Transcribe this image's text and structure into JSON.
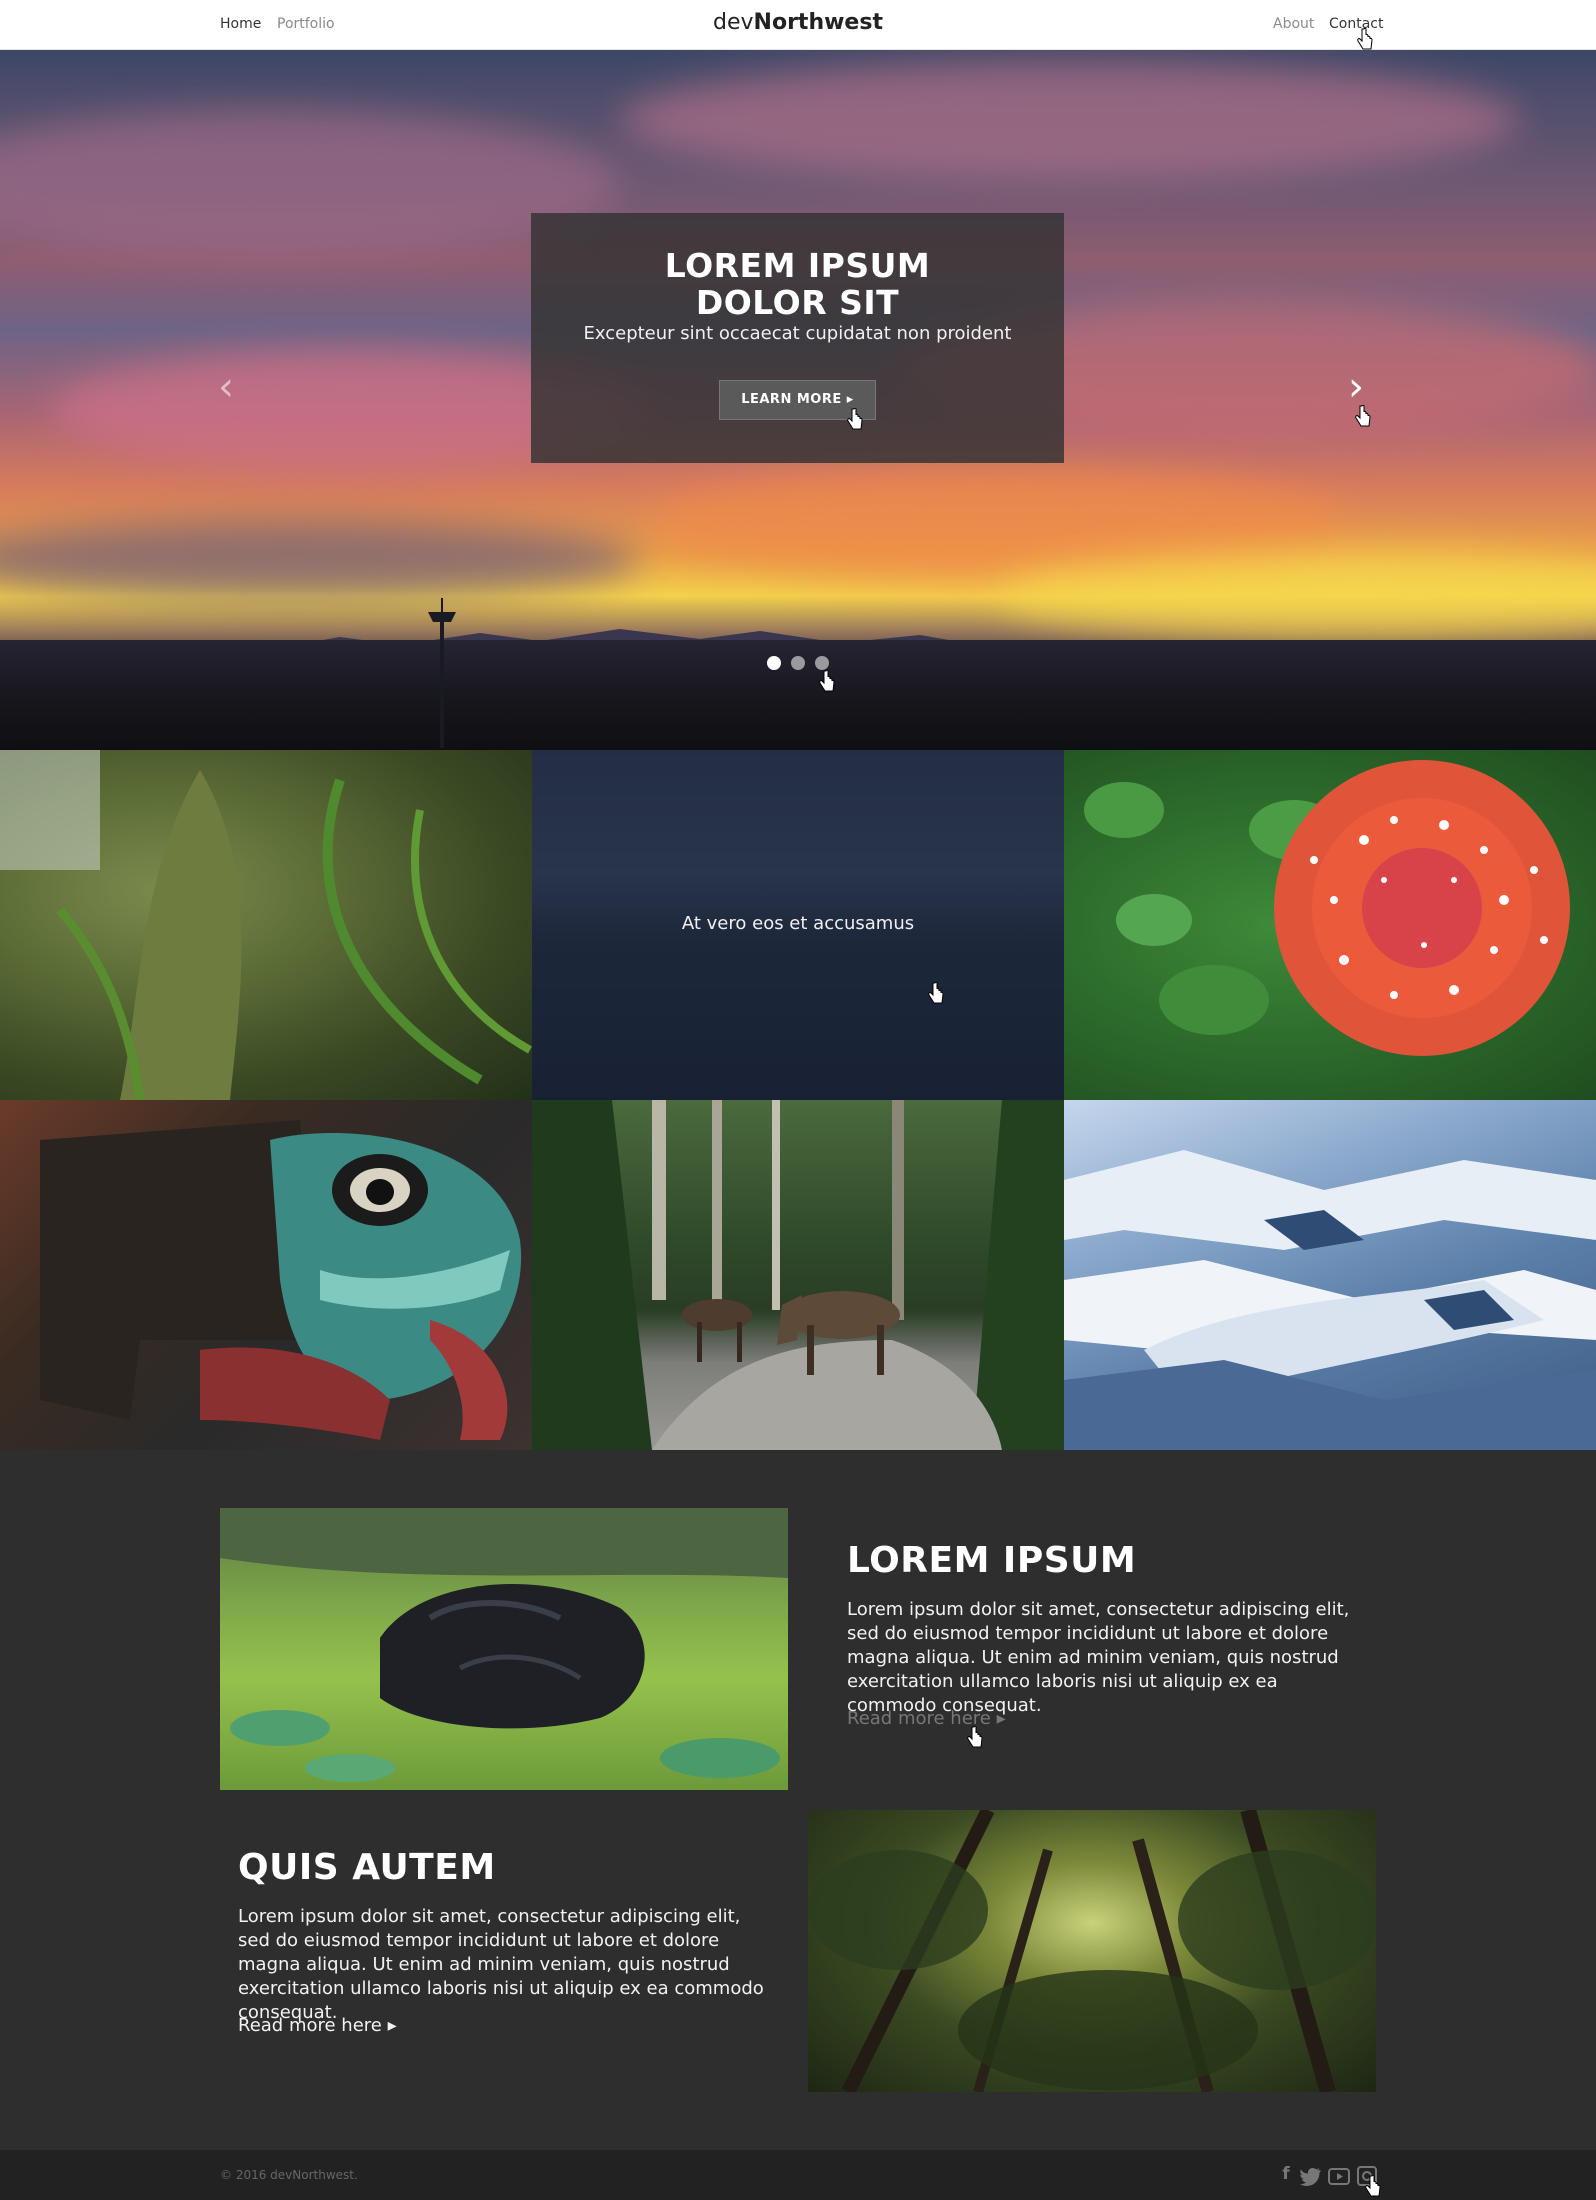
{
  "header": {
    "nav_left": [
      "Home",
      "Portfolio"
    ],
    "logo_light": "dev",
    "logo_bold": "Northwest",
    "nav_right": [
      "About",
      "Contact"
    ]
  },
  "hero": {
    "title_line1": "LOREM IPSUM",
    "title_line2": "DOLOR SIT",
    "subtitle": "Excepteur sint occaecat cupidatat non proident",
    "button_label": "LEARN MORE ▸",
    "prev_arrow": "‹",
    "next_arrow": "›",
    "slide_count": 3,
    "active_slide": 1
  },
  "gallery": {
    "tiles": [
      "moss-fern-photo",
      "ocean-dusk-photo",
      "mushroom-photo",
      "totem-photo",
      "moose-road-photo",
      "glacier-photo"
    ],
    "overlay_text": "At vero eos et accusamus"
  },
  "features": [
    {
      "title": "LOREM IPSUM",
      "text": "Lorem ipsum dolor sit amet, consectetur adipiscing elit, sed do eiusmod tempor incididunt ut labore et dolore magna aliqua. Ut enim ad minim veniam, quis nostrud exercitation ullamco laboris nisi ut aliquip ex ea commodo consequat.",
      "link": "Read more here ▸"
    },
    {
      "title": "QUIS AUTEM",
      "text": "Lorem ipsum dolor sit amet, consectetur adipiscing elit, sed do eiusmod tempor incididunt ut labore et dolore magna aliqua. Ut enim ad minim veniam, quis nostrud exercitation ullamco laboris nisi ut aliquip ex ea commodo consequat.",
      "link": "Read more here ▸"
    }
  ],
  "footer": {
    "copyright": "© 2016 devNorthwest.",
    "social_icons": [
      "facebook-icon",
      "twitter-icon",
      "youtube-icon",
      "instagram-icon"
    ]
  },
  "colors": {
    "header_bg": "#ffffff",
    "section_bg": "#2e2e2e",
    "footer_bg": "#222222",
    "caption_bg": "#323232"
  }
}
